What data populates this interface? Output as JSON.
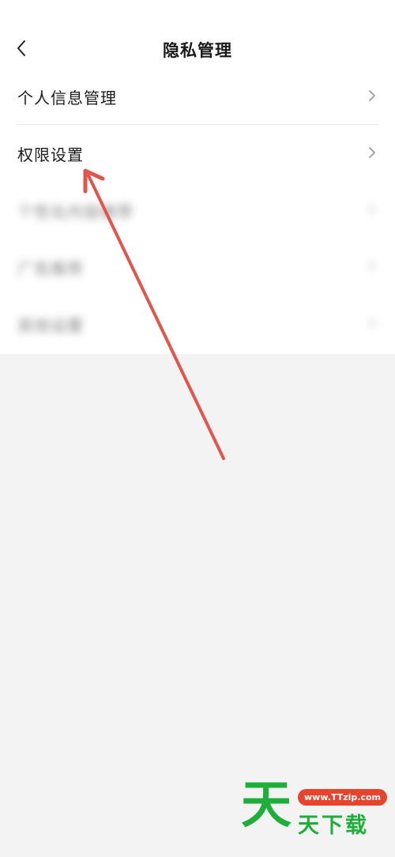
{
  "header": {
    "title": "隐私管理",
    "back_icon": "chevron-left-icon"
  },
  "menu": {
    "items": [
      {
        "label": "个人信息管理"
      },
      {
        "label": "权限设置"
      },
      {
        "label": "个性化内容推荐"
      },
      {
        "label": "广告推荐"
      },
      {
        "label": "其他设置"
      }
    ]
  },
  "annotation": {
    "arrow_color": "#e0564e"
  },
  "watermark": {
    "big_char": "天",
    "url": "www.TTzip.com",
    "brand": "天下载",
    "brand_color": "#1fae3a",
    "url_bg_color": "#e8432d"
  }
}
